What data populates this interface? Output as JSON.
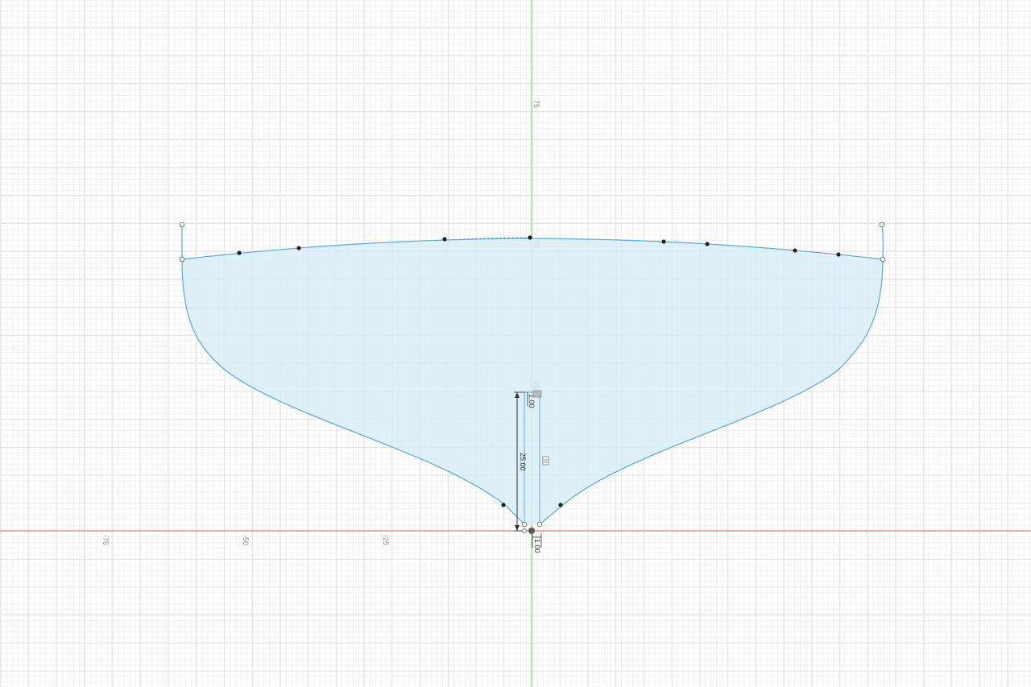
{
  "viewport": {
    "axis_x_color": "#e06060",
    "axis_y_color": "#6fcf6f",
    "profile_stroke": "#5aaad6",
    "profile_fill": "#d8ecf8",
    "grid_minor_color": "#f1f1f1",
    "grid_major_color": "#e2e2e2"
  },
  "axis_labels": {
    "x_neg75": "-75",
    "x_neg50": "-50",
    "x_neg25": "-25",
    "y_75": "75",
    "y_50": "50",
    "y_25": "25"
  },
  "dimensions": {
    "vertical_height": "25.00",
    "top_offset": "1.00",
    "bottom_offset": "1.00"
  },
  "icons": {
    "constraint_1": "horizontal-constraint-icon",
    "constraint_2": "vertical-constraint-icon"
  }
}
